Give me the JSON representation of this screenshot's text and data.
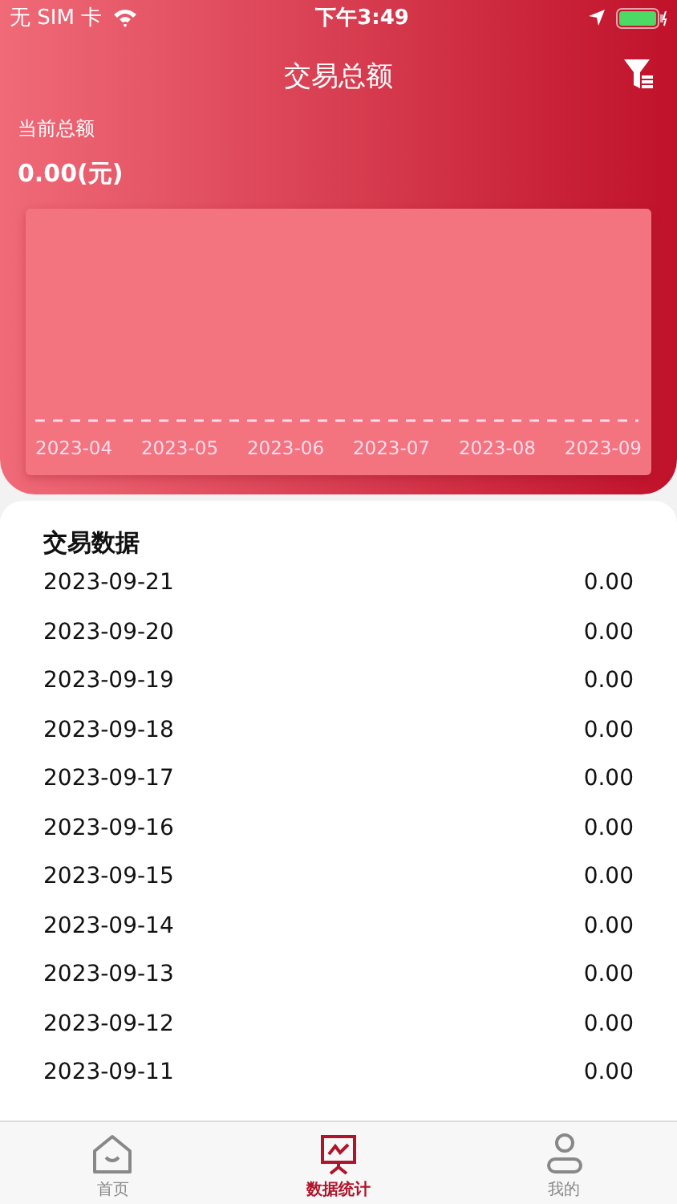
{
  "status_bar": {
    "carrier": "无 SIM 卡",
    "time": "下午3:49"
  },
  "header": {
    "title": "交易总额",
    "total_label": "当前总额",
    "total_value": "0.00(元)"
  },
  "chart": {
    "x_labels": [
      "2023-04",
      "2023-05",
      "2023-06",
      "2023-07",
      "2023-08",
      "2023-09"
    ]
  },
  "list": {
    "title": "交易数据",
    "rows": [
      {
        "date": "2023-09-21",
        "amount": "0.00"
      },
      {
        "date": "2023-09-20",
        "amount": "0.00"
      },
      {
        "date": "2023-09-19",
        "amount": "0.00"
      },
      {
        "date": "2023-09-18",
        "amount": "0.00"
      },
      {
        "date": "2023-09-17",
        "amount": "0.00"
      },
      {
        "date": "2023-09-16",
        "amount": "0.00"
      },
      {
        "date": "2023-09-15",
        "amount": "0.00"
      },
      {
        "date": "2023-09-14",
        "amount": "0.00"
      },
      {
        "date": "2023-09-13",
        "amount": "0.00"
      },
      {
        "date": "2023-09-12",
        "amount": "0.00"
      },
      {
        "date": "2023-09-11",
        "amount": "0.00"
      }
    ]
  },
  "tab_bar": [
    {
      "label": "首页",
      "kind": "home",
      "selected": false
    },
    {
      "label": "数据统计",
      "kind": "stats",
      "selected": true
    },
    {
      "label": "我的",
      "kind": "profile",
      "selected": false
    }
  ]
}
